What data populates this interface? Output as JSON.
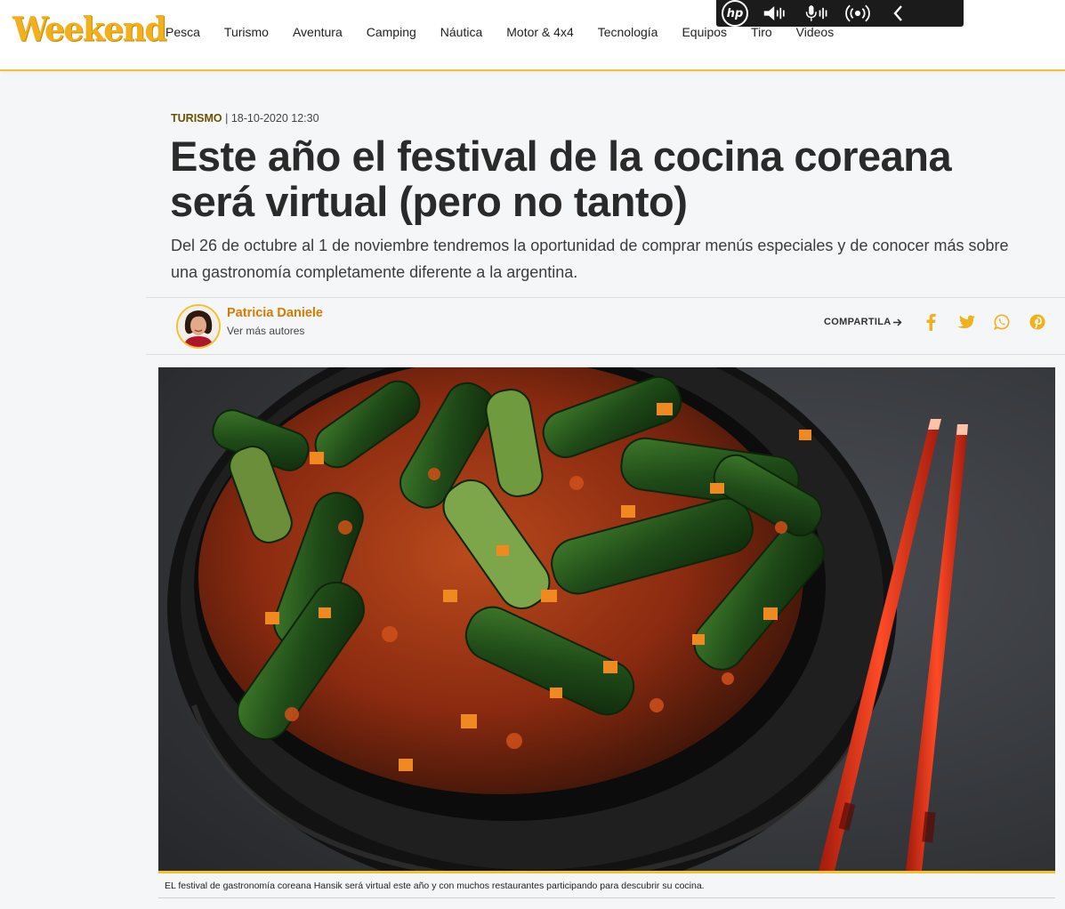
{
  "header": {
    "logo": "Weekend",
    "nav": [
      "Pesca",
      "Turismo",
      "Aventura",
      "Camping",
      "Náutica",
      "Motor & 4x4",
      "Tecnología",
      "Equipos",
      "Tiro",
      "Videos"
    ]
  },
  "hp_toolbar": {
    "logo": "hp",
    "icons": [
      "speaker-mute-icon",
      "microphone-mute-icon",
      "broadcast-icon",
      "chevron-left-icon"
    ]
  },
  "article": {
    "category": "TURISMO",
    "separator": " | ",
    "date": "18-10-2020 12:30",
    "title": "Este año el festival de la cocina coreana será virtual (pero no tanto)",
    "subtitle": "Del 26 de octubre al 1 de noviembre tendremos la oportunidad de comprar menús especiales y de conocer más sobre una gastronomía completamente diferente a la argentina.",
    "author": {
      "name": "Patricia Daniele",
      "more_label": "Ver más autores"
    },
    "share": {
      "label": "COMPARTILA",
      "icons": [
        "facebook-icon",
        "twitter-icon",
        "whatsapp-icon",
        "pinterest-icon"
      ]
    },
    "caption": "EL festival de gastronomía coreana Hansik será virtual este año y con muchos restaurantes participando para descubrir su cocina."
  },
  "colors": {
    "brand": "#f2c12e",
    "author": "#d87a00",
    "chopsticks": "#e03a1e"
  }
}
